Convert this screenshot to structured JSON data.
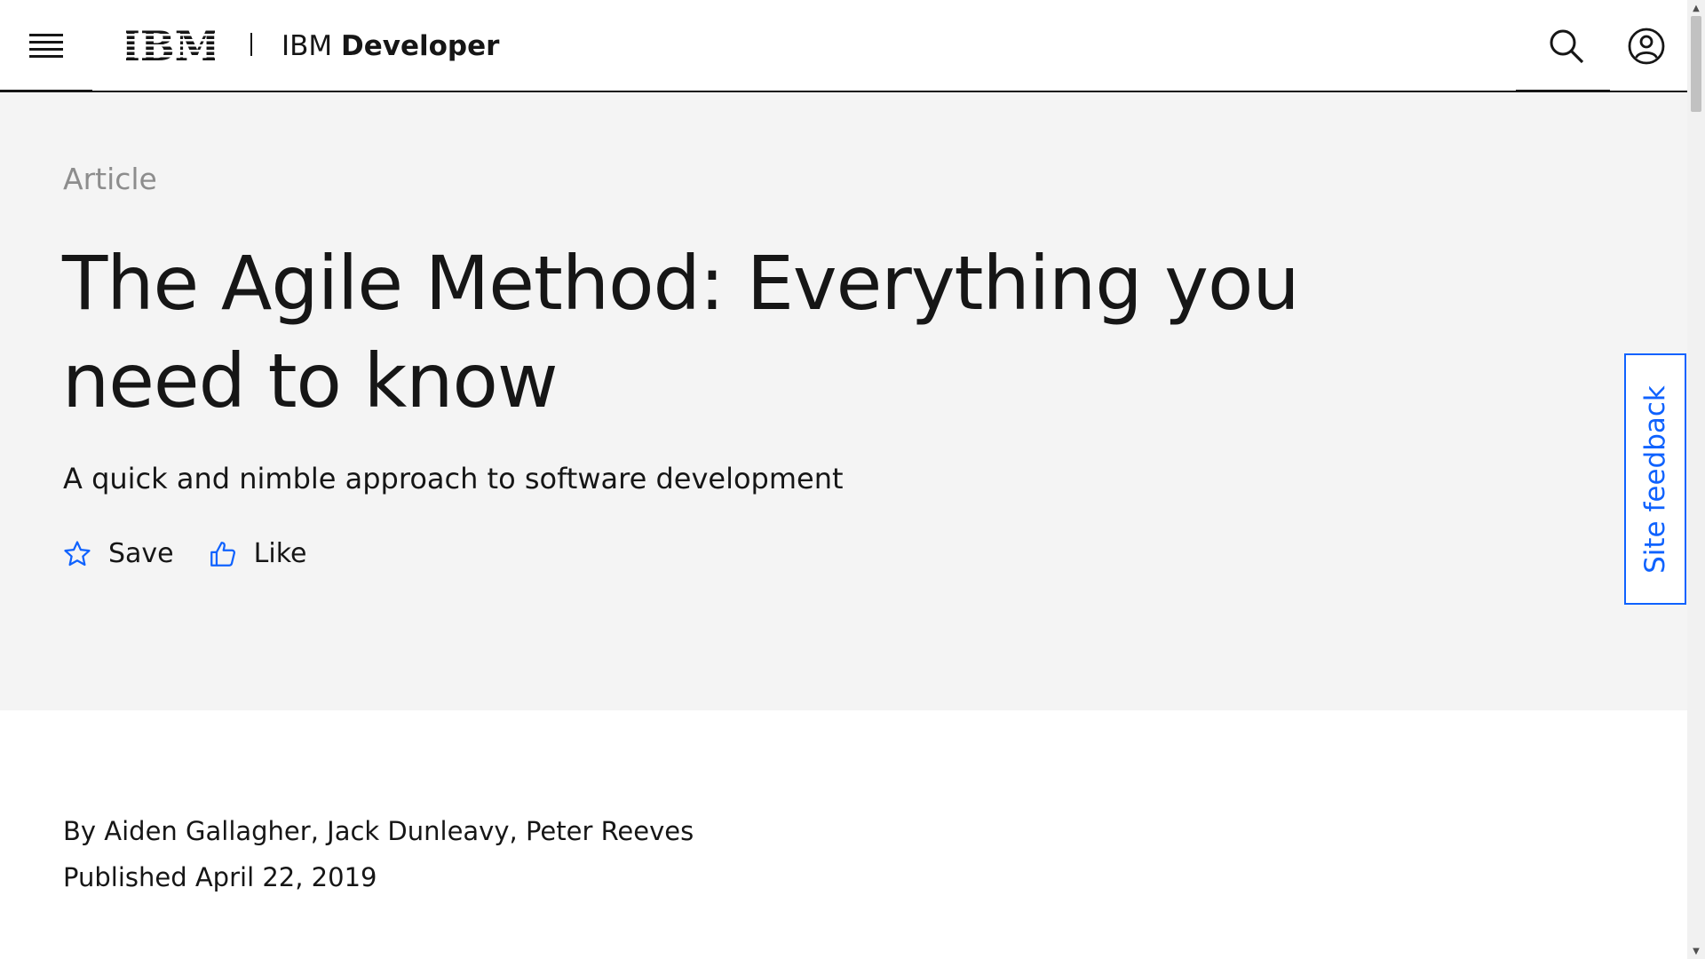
{
  "header": {
    "logo_text": "IBM",
    "brand_light": "IBM ",
    "brand_bold": "Developer"
  },
  "hero": {
    "eyebrow": "Article",
    "title": "The Agile Method: Everything you need to know",
    "subtitle": "A quick and nimble approach to software development",
    "actions": {
      "save_label": "Save",
      "like_label": "Like"
    }
  },
  "feedback": {
    "label": "Site feedback"
  },
  "meta": {
    "authors": "By Aiden Gallagher, Jack Dunleavy, Peter Reeves",
    "published": "Published April 22, 2019"
  },
  "icons": {
    "menu": "hamburger-menu-icon",
    "search": "search-icon",
    "user": "user-avatar-icon",
    "save": "star-icon",
    "like": "thumbs-up-icon"
  },
  "colors": {
    "accent": "#0f62fe",
    "hero_bg": "#f4f4f4",
    "text": "#161616",
    "muted": "#8d8d8d"
  }
}
